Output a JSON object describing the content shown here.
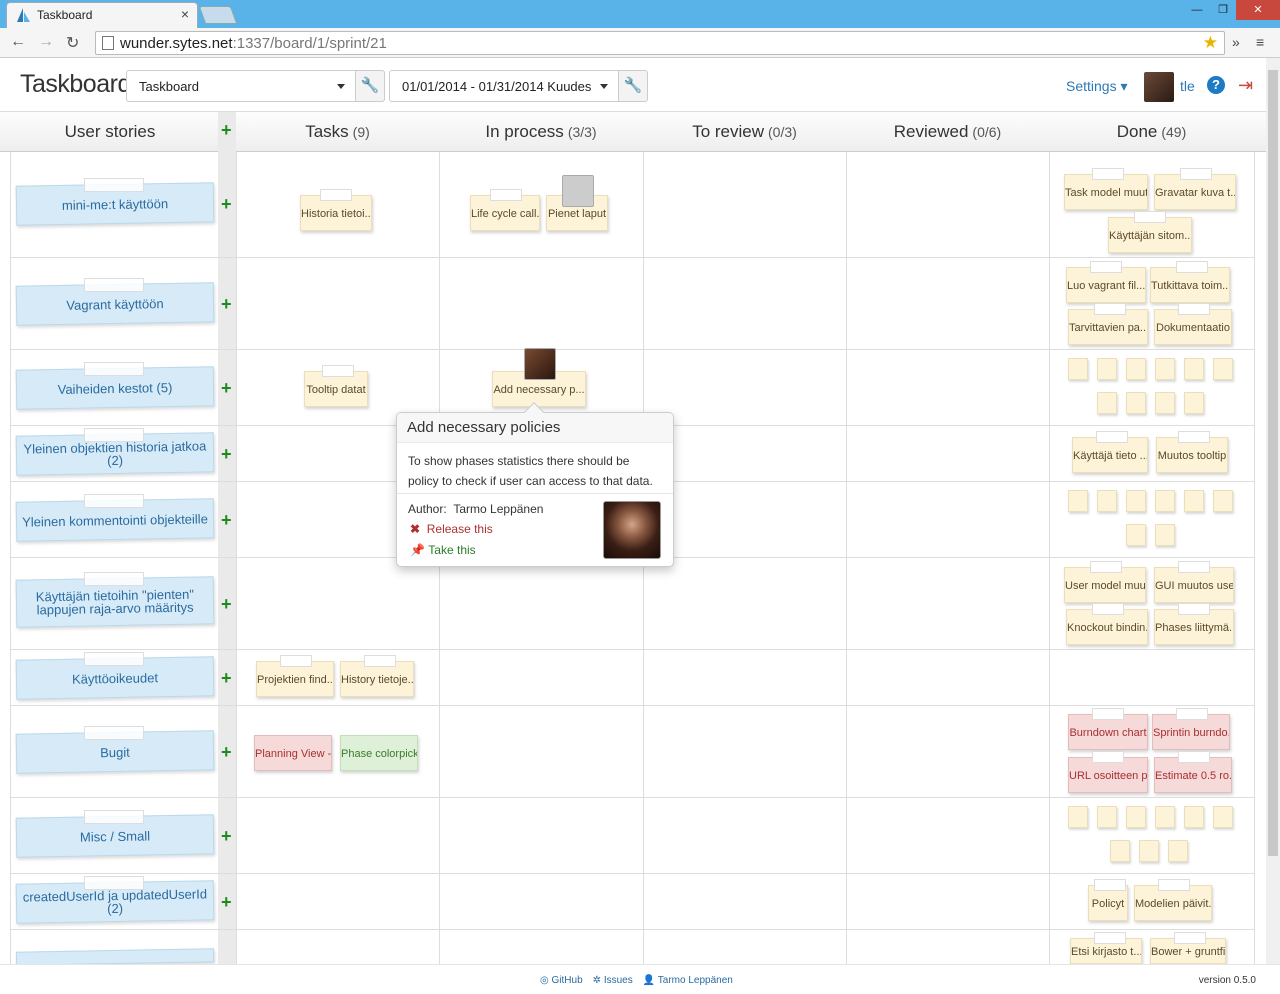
{
  "browser": {
    "tab_title": "Taskboard",
    "url_host": "wunder.sytes.net",
    "url_path": ":1337/board/1/sprint/21"
  },
  "header": {
    "brand": "Taskboard",
    "project_select": "Taskboard",
    "sprint_select": "01/01/2014 - 01/31/2014 Kuudes",
    "settings": "Settings",
    "username": "tle",
    "help": "?"
  },
  "columns": [
    {
      "label": "User stories",
      "count": ""
    },
    {
      "label": "Tasks",
      "count": "(9)"
    },
    {
      "label": "In process",
      "count": "(3/3)"
    },
    {
      "label": "To review",
      "count": "(0/3)"
    },
    {
      "label": "Reviewed",
      "count": "(0/6)"
    },
    {
      "label": "Done",
      "count": "(49)"
    }
  ],
  "stories": [
    "mini-me:t käyttöön",
    "Vagrant käyttöön",
    "Vaiheiden kestot (5)",
    "Yleinen objektien historia jatkoa (2)",
    "Yleinen kommentointi objekteille",
    "Käyttäjän tietoihin \"pienten\" lappujen raja-arvo määritys",
    "Käyttöoikeudet",
    "Bugit",
    "Misc / Small",
    "createdUserId ja updatedUserId (2)"
  ],
  "tasks": {
    "r1_tasks": "Historia tietoi...",
    "r1_inproc_a": "Life cycle call...",
    "r1_inproc_b": "Pienet laput",
    "r1_done_a": "Task model muut...",
    "r1_done_b": "Gravatar kuva t...",
    "r1_done_c": "Käyttäjän sitom...",
    "r2_done_a": "Luo vagrant fil...",
    "r2_done_b": "Tutkittava toim...",
    "r2_done_c": "Tarvittavien pa...",
    "r2_done_d": "Dokumentaatio",
    "r3_tasks": "Tooltip datat",
    "r3_inproc": "Add necessary p...",
    "r4_done_a": "Käyttäjä tieto ...",
    "r4_done_b": "Muutos tooltip",
    "r6_done_a": "User model muut...",
    "r6_done_b": "GUI muutos user...",
    "r6_done_c": "Knockout bindin...",
    "r6_done_d": "Phases liittymä...",
    "r7_tasks_a": "Projektien find...",
    "r7_tasks_b": "History tietoje...",
    "r8_tasks_a": "Planning View -...",
    "r8_tasks_b": "Phase colorpick...",
    "r8_done_a": "Burndown chart",
    "r8_done_b": "Sprintin burndo...",
    "r8_done_c": "URL osoitteen p...",
    "r8_done_d": "Estimate 0.5 ro...",
    "r10_done_a": "Policyt",
    "r10_done_b": "Modelien päivit...",
    "r11_done_a": "Etsi kirjasto t...",
    "r11_done_b": "Bower + gruntfi..."
  },
  "popover": {
    "title": "Add necessary policies",
    "description": "To show phases statistics there should be policy to check if user can access to that data.",
    "author_label": "Author:",
    "author_name": "Tarmo Leppänen",
    "release": "Release this",
    "take": "Take this"
  },
  "footer": {
    "github": "GitHub",
    "issues": "Issues",
    "author": "Tarmo Leppänen",
    "version": "version 0.5.0"
  },
  "colors": {
    "story_bg": "#d6ebf7",
    "note_bg": "#fdf3d8",
    "note_red": "#f6d9d9",
    "note_green": "#def0d8",
    "plus_green": "#1c8a1c",
    "link_blue": "#2a7ab8"
  }
}
